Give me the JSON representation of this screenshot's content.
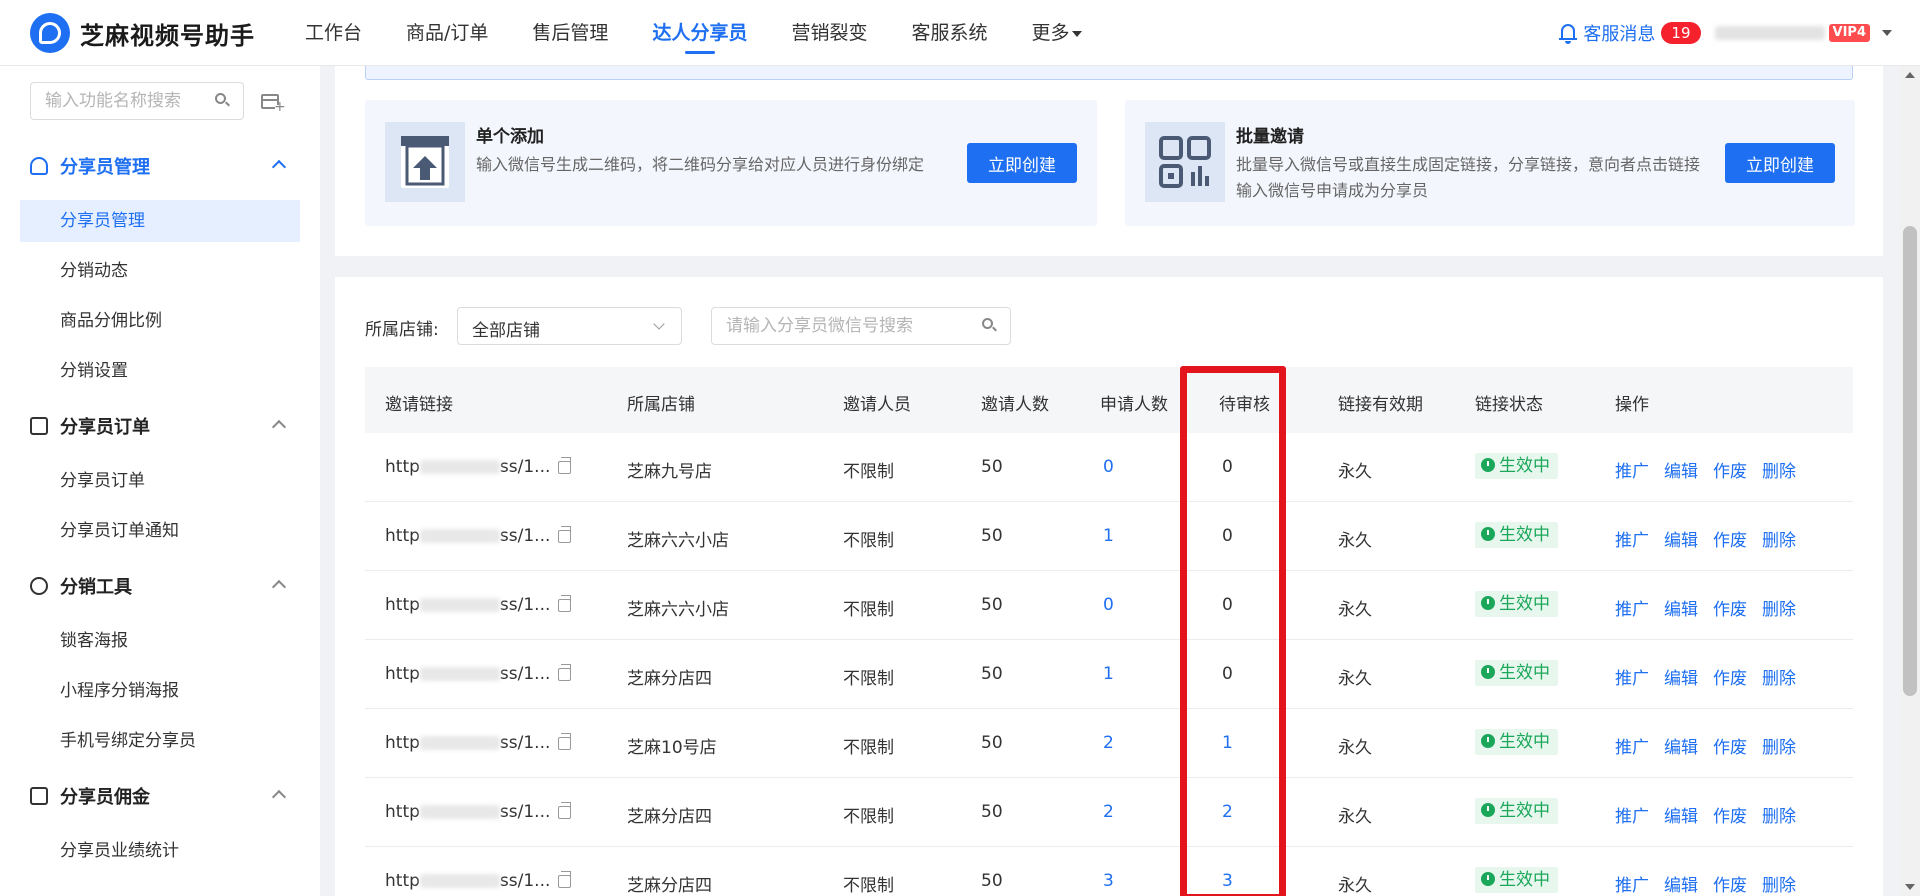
{
  "app": {
    "title": "芝麻视频号助手"
  },
  "nav": [
    "工作台",
    "商品/订单",
    "售后管理",
    "达人分享员",
    "营销裂变",
    "客服系统",
    "更多"
  ],
  "nav_active": "达人分享员",
  "header": {
    "message_label": "客服消息",
    "message_count": "19",
    "vip_label": "VIP4"
  },
  "sidebar": {
    "search_placeholder": "输入功能名称搜索",
    "groups": [
      {
        "title": "分享员管理",
        "items": [
          "分享员管理",
          "分销动态",
          "商品分佣比例",
          "分销设置"
        ]
      },
      {
        "title": "分享员订单",
        "items": [
          "分享员订单",
          "分享员订单通知"
        ]
      },
      {
        "title": "分销工具",
        "items": [
          "锁客海报",
          "小程序分销海报",
          "手机号绑定分享员"
        ]
      },
      {
        "title": "分享员佣金",
        "items": [
          "分享员业绩统计"
        ]
      }
    ]
  },
  "add_cards": [
    {
      "title": "单个添加",
      "desc": "输入微信号生成二维码，将二维码分享给对应人员进行身份绑定",
      "button": "立即创建",
      "icon": "upload-box-icon"
    },
    {
      "title": "批量邀请",
      "desc": "批量导入微信号或直接生成固定链接，分享链接，意向者点击链接输入微信号申请成为分享员",
      "button": "立即创建",
      "icon": "qrcode-chart-icon"
    }
  ],
  "filter": {
    "store_label": "所属店铺:",
    "store_value": "全部店铺",
    "search_placeholder": "请输入分享员微信号搜索"
  },
  "table": {
    "headers": [
      "邀请链接",
      "所属店铺",
      "邀请人员",
      "邀请人数",
      "申请人数",
      "待审核",
      "链接有效期",
      "链接状态",
      "操作"
    ],
    "rows": [
      {
        "link_prefix": "http",
        "link_suffix": "ss/1...",
        "store": "芝麻九号店",
        "inviter": "不限制",
        "invite_count": "50",
        "apply_count": "0",
        "pending": "0",
        "validity": "永久",
        "status": "生效中"
      },
      {
        "link_prefix": "http",
        "link_suffix": "ss/1...",
        "store": "芝麻六六小店",
        "inviter": "不限制",
        "invite_count": "50",
        "apply_count": "1",
        "pending": "0",
        "validity": "永久",
        "status": "生效中"
      },
      {
        "link_prefix": "http",
        "link_suffix": "ss/1...",
        "store": "芝麻六六小店",
        "inviter": "不限制",
        "invite_count": "50",
        "apply_count": "0",
        "pending": "0",
        "validity": "永久",
        "status": "生效中"
      },
      {
        "link_prefix": "http",
        "link_suffix": "ss/1...",
        "store": "芝麻分店四",
        "inviter": "不限制",
        "invite_count": "50",
        "apply_count": "1",
        "pending": "0",
        "validity": "永久",
        "status": "生效中"
      },
      {
        "link_prefix": "http",
        "link_suffix": "ss/1...",
        "store": "芝麻10号店",
        "inviter": "不限制",
        "invite_count": "50",
        "apply_count": "2",
        "pending": "1",
        "validity": "永久",
        "status": "生效中"
      },
      {
        "link_prefix": "http",
        "link_suffix": "ss/1...",
        "store": "芝麻分店四",
        "inviter": "不限制",
        "invite_count": "50",
        "apply_count": "2",
        "pending": "2",
        "validity": "永久",
        "status": "生效中"
      },
      {
        "link_prefix": "http",
        "link_suffix": "ss/1...",
        "store": "芝麻分店四",
        "inviter": "不限制",
        "invite_count": "50",
        "apply_count": "3",
        "pending": "3",
        "validity": "永久",
        "status": "生效中"
      }
    ],
    "actions": [
      "推广",
      "编辑",
      "作废",
      "删除"
    ]
  },
  "colors": {
    "primary": "#1e6ff1",
    "success": "#1aa75a",
    "highlight": "#e3141b",
    "badge": "#f5222d"
  }
}
